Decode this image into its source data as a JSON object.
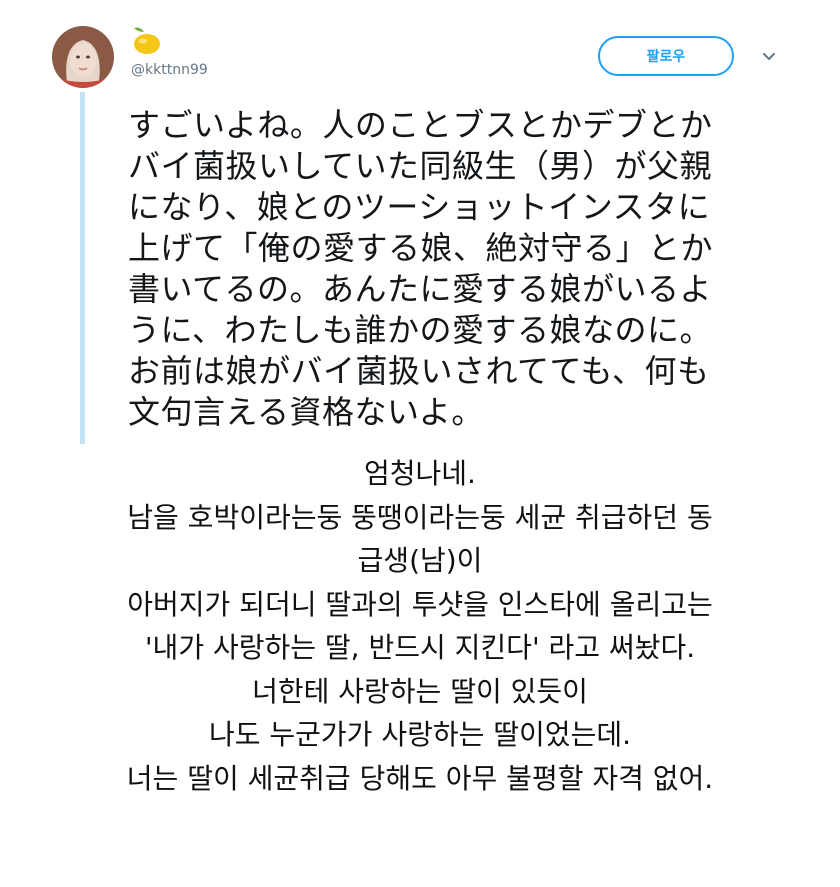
{
  "tweet": {
    "handle": "@kkttnn99",
    "emoji_icon": "lemon-icon",
    "follow_label": "팔로우",
    "more_icon": "chevron-down-icon",
    "accent_color": "#1da1f2",
    "text_lines": [
      "すごいよね。人のことブスとかデブとか",
      "バイ菌扱いしていた同級生（男）が父親",
      "になり、娘とのツーショットインスタに",
      "上げて「俺の愛する娘、絶対守る」とか",
      "書いてるの。あんたに愛する娘がいるよ",
      "うに、わたしも誰かの愛する娘なのに。",
      "お前は娘がバイ菌扱いされてても、何も",
      "文句言える資格ないよ。"
    ]
  },
  "translation": {
    "lines": [
      "엄청나네.",
      "남을 호박이라는둥 뚱땡이라는둥 세균 취급하던 동",
      "급생(남)이",
      "아버지가 되더니 딸과의 투샷을 인스타에 올리고는",
      "'내가 사랑하는 딸, 반드시 지킨다' 라고 써놨다.",
      "너한테 사랑하는 딸이 있듯이",
      "나도 누군가가 사랑하는 딸이었는데.",
      "너는 딸이 세균취급 당해도 아무 불평할 자격 없어."
    ]
  }
}
